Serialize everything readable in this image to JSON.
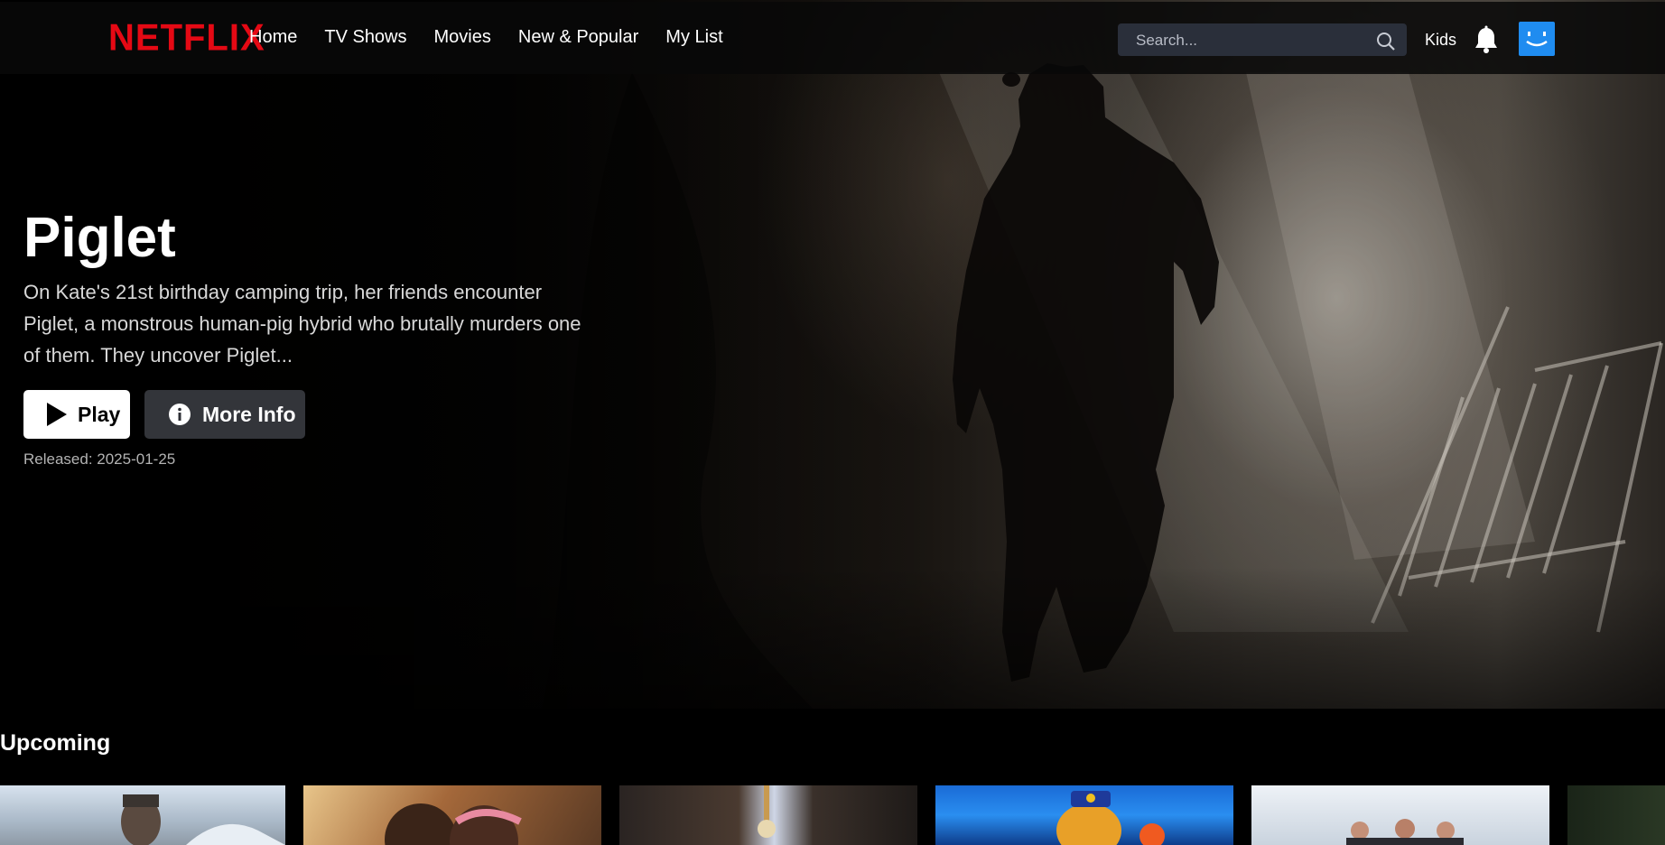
{
  "brand": {
    "logo": "NETFLIX",
    "color": "#e50914"
  },
  "nav": {
    "links": [
      "Home",
      "TV Shows",
      "Movies",
      "New & Popular",
      "My List"
    ],
    "search_placeholder": "Search...",
    "kids_label": "Kids",
    "icons": {
      "search": "search-icon",
      "notifications": "bell-icon",
      "profile": "smiley-avatar"
    },
    "avatar_color": "#1f8cf0"
  },
  "hero": {
    "title": "Piglet",
    "description": "On Kate's 21st birthday camping trip, her friends encounter Piglet, a monstrous human-pig hybrid who brutally murders one of them. They uncover Piglet...",
    "play_label": "Play",
    "more_info_label": "More Info",
    "released": "Released: 2025-01-25"
  },
  "rows": [
    {
      "title": "Upcoming",
      "tile_count": 6
    }
  ]
}
